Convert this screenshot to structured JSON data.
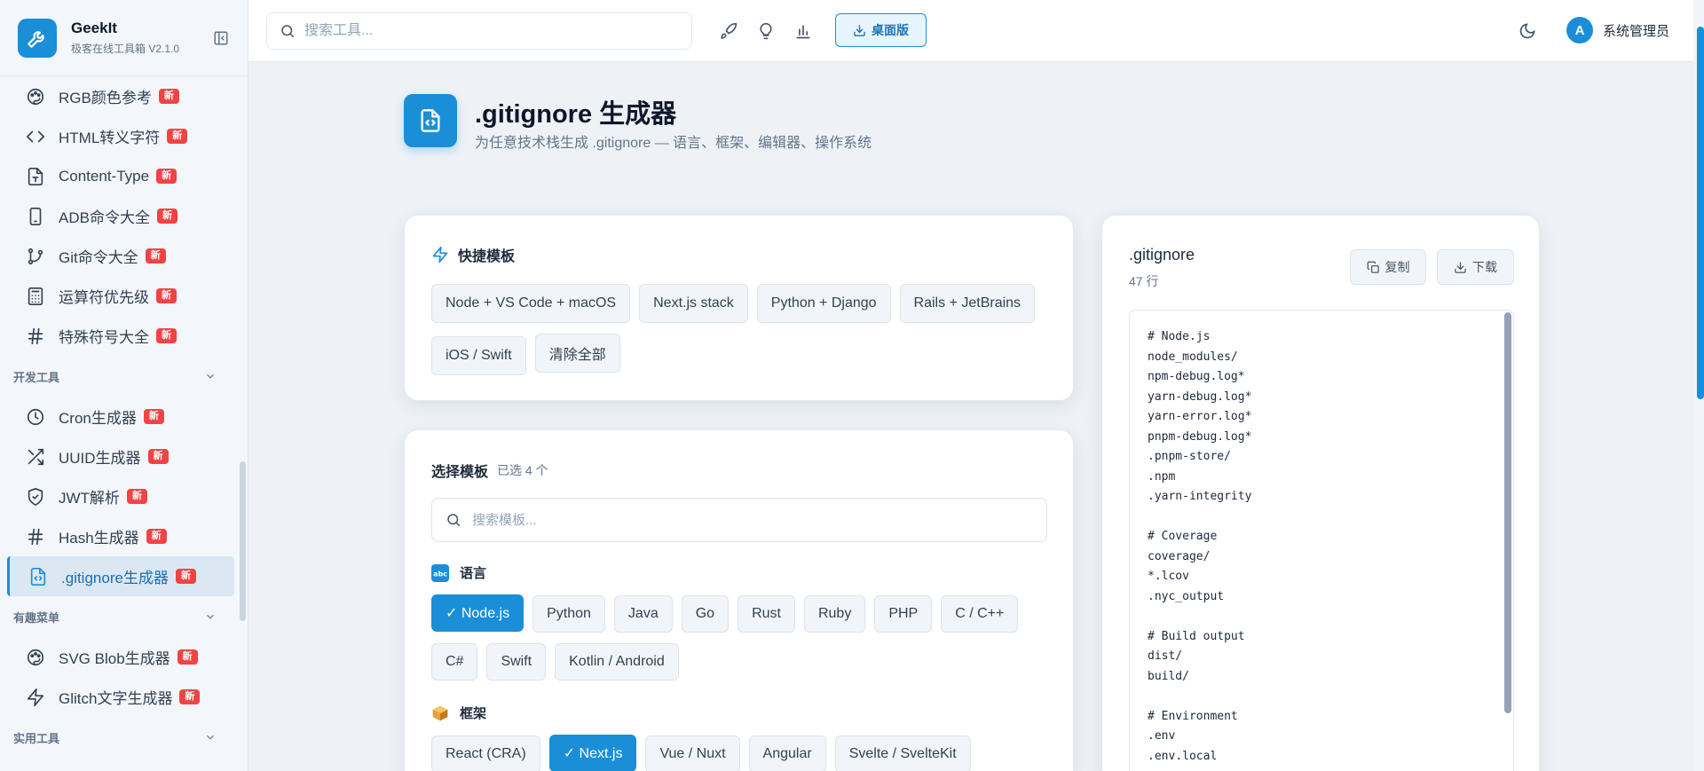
{
  "brand": {
    "name": "GeekIt",
    "subtitle": "极客在线工具箱",
    "version": "V2.1.0"
  },
  "sidebar": {
    "new_badge": "新",
    "items_top": [
      {
        "label": "RGB颜色参考",
        "icon": "palette-icon"
      },
      {
        "label": "HTML转义字符",
        "icon": "code-brackets-icon"
      },
      {
        "label": "Content-Type",
        "icon": "file-type-icon"
      },
      {
        "label": "ADB命令大全",
        "icon": "smartphone-icon"
      },
      {
        "label": "Git命令大全",
        "icon": "git-branch-icon"
      },
      {
        "label": "运算符优先级",
        "icon": "calculator-icon"
      },
      {
        "label": "特殊符号大全",
        "icon": "hash-icon"
      }
    ],
    "group_dev": "开发工具",
    "items_dev": [
      {
        "label": "Cron生成器",
        "icon": "clock-icon"
      },
      {
        "label": "UUID生成器",
        "icon": "shuffle-icon"
      },
      {
        "label": "JWT解析",
        "icon": "shield-icon"
      },
      {
        "label": "Hash生成器",
        "icon": "hash-icon"
      },
      {
        "label": ".gitignore生成器",
        "icon": "file-code-icon"
      }
    ],
    "group_fun": "有趣菜单",
    "items_fun": [
      {
        "label": "SVG Blob生成器",
        "icon": "palette-icon"
      },
      {
        "label": "Glitch文字生成器",
        "icon": "zap-icon"
      }
    ],
    "group_util": "实用工具"
  },
  "header": {
    "search_placeholder": "搜索工具...",
    "desktop_label": "桌面版",
    "user_initial": "A",
    "user_name": "系统管理员"
  },
  "page": {
    "title": ".gitignore 生成器",
    "subtitle": "为任意技术栈生成 .gitignore — 语言、框架、编辑器、操作系统"
  },
  "quick": {
    "title": "快捷模板",
    "templates": [
      "Node + VS Code + macOS",
      "Next.js stack",
      "Python + Django",
      "Rails + JetBrains",
      "iOS / Swift",
      "清除全部"
    ]
  },
  "select": {
    "title": "选择模板",
    "count": "已选 4 个",
    "search_placeholder": "搜索模板...",
    "languages_title": "语言",
    "languages": [
      {
        "label": "✓ Node.js",
        "on": true
      },
      {
        "label": "Python",
        "on": false
      },
      {
        "label": "Java",
        "on": false
      },
      {
        "label": "Go",
        "on": false
      },
      {
        "label": "Rust",
        "on": false
      },
      {
        "label": "Ruby",
        "on": false
      },
      {
        "label": "PHP",
        "on": false
      },
      {
        "label": "C / C++",
        "on": false
      },
      {
        "label": "C#",
        "on": false
      },
      {
        "label": "Swift",
        "on": false
      },
      {
        "label": "Kotlin / Android",
        "on": false
      }
    ],
    "frameworks_title": "框架",
    "frameworks": [
      {
        "label": "React (CRA)",
        "on": false
      },
      {
        "label": "✓ Next.js",
        "on": true
      },
      {
        "label": "Vue / Nuxt",
        "on": false
      },
      {
        "label": "Angular",
        "on": false
      },
      {
        "label": "Svelte / SvelteKit",
        "on": false
      }
    ]
  },
  "output": {
    "title": ".gitignore",
    "lines": "47 行",
    "copy_label": "复制",
    "download_label": "下载",
    "code": "# Node.js\nnode_modules/\nnpm-debug.log*\nyarn-debug.log*\nyarn-error.log*\npnpm-debug.log*\n.pnpm-store/\n.npm\n.yarn-integrity\n\n# Coverage\ncoverage/\n*.lcov\n.nyc_output\n\n# Build output\ndist/\nbuild/\n\n# Environment\n.env\n.env.local"
  },
  "colors": {
    "accent": "#1a8fd8",
    "badge": "#ef4444"
  }
}
